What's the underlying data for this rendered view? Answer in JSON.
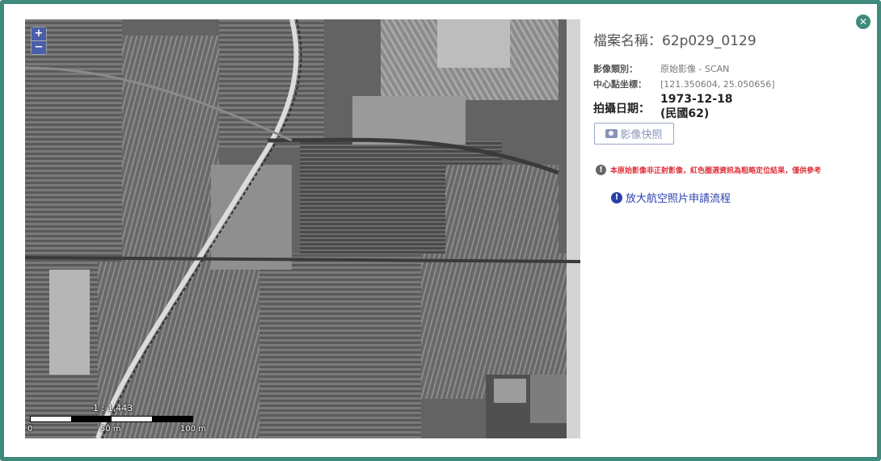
{
  "map": {
    "zoom_in_label": "+",
    "zoom_out_label": "−",
    "scale_ratio": "1 : 1,443",
    "scale_ticks": [
      "0",
      "50 m",
      "100 m"
    ]
  },
  "info": {
    "close_label": "✕",
    "file_label": "檔案名稱：",
    "file_value": "62p029_0129",
    "type_label": "影像類別：",
    "type_value": "原始影像 - SCAN",
    "center_label": "中心點坐標：",
    "center_value": "[121.350604, 25.050656]",
    "date_label": "拍攝日期：",
    "date_value": "1973-12-18",
    "date_roc": "(民國62)",
    "snapshot_button": "影像快照",
    "warning_text": "本原始影像非正射影像，紅色圈選資訊為粗略定位結果，僅供參考",
    "apply_link": "放大航空照片申請流程"
  },
  "colors": {
    "frame": "#3f8a7c",
    "warning": "#e0323c",
    "link": "#2a3faa"
  }
}
